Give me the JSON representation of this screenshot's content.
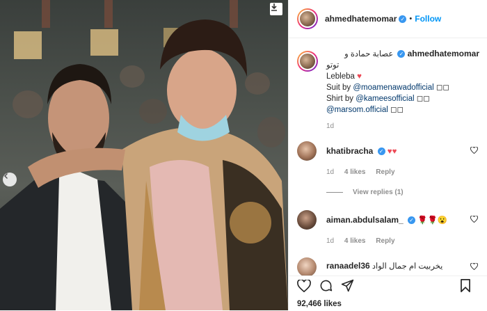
{
  "post": {
    "username": "ahmedhatemomar",
    "follow_label": "Follow",
    "dot": "•",
    "caption_lines": [
      "عصابة حمادة و",
      "توتو"
    ],
    "caption_lebleba": "Lebleba",
    "caption_heart": "♥",
    "credits": [
      {
        "prefix": "Suit by ",
        "mention": "@moamenawadofficial",
        "suffix": " ◻◻"
      },
      {
        "prefix": "Shirt by ",
        "mention": "@kameesofficial",
        "suffix": " ◻◻"
      },
      {
        "prefix": "",
        "mention": "@marsom.official",
        "suffix": " ◻◻"
      }
    ],
    "time": "1d",
    "likes_count": "92,466 likes"
  },
  "comments": [
    {
      "username": "khatibracha",
      "text": "♥♥",
      "time": "1d",
      "likes": "4 likes",
      "reply": "Reply",
      "view_replies": "View replies (1)"
    },
    {
      "username": "aiman.abdulsalam_",
      "text": "🌹🌹😮",
      "time": "1d",
      "likes": "4 likes",
      "reply": "Reply"
    },
    {
      "username": "ranaadel36",
      "text": "يخربيت ام جمال الواد"
    }
  ],
  "icons": {
    "download": "download-icon",
    "prev": "chevron-left-icon",
    "heart": "heart-icon",
    "comment": "comment-icon",
    "share": "share-icon",
    "save": "bookmark-icon",
    "verified": "verified-badge-icon"
  },
  "colors": {
    "accent": "#0095f6",
    "verified": "#3897f0",
    "heart": "#ed4956"
  }
}
